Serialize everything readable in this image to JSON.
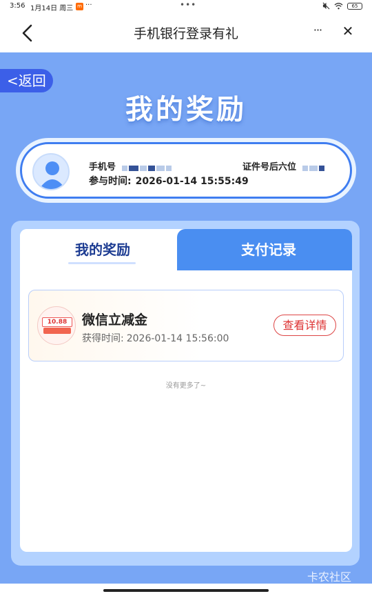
{
  "status_bar": {
    "time": "3:56",
    "date": "1月14日 周三",
    "notif_more": "···",
    "center_dots": "•••",
    "battery": "65"
  },
  "title_bar": {
    "title": "手机银行登录有礼",
    "more": "···",
    "close": "✕"
  },
  "banner": {
    "return_label": "<返回",
    "title": "我的奖励"
  },
  "user": {
    "phone_label": "手机号",
    "id_label": "证件号后六位",
    "join_label": "参与时间:",
    "join_time": "2026-01-14 15:55:49"
  },
  "tabs": [
    {
      "label": "我的奖励",
      "active": true
    },
    {
      "label": "支付记录",
      "active": false
    }
  ],
  "rewards": [
    {
      "icon_amount": "10.88",
      "name": "微信立减金",
      "time_label": "获得时间:",
      "time": "2026-01-14 15:56:00",
      "button": "查看详情"
    }
  ],
  "no_more": "没有更多了~",
  "watermark": "卡农社区",
  "colors": {
    "page_bg": "#78a6f5",
    "return_btn": "#3c5fe8",
    "tab_active_text": "#1d3c92",
    "tab_inactive_bg": "#4a8ef1",
    "detail_btn": "#d33333"
  }
}
